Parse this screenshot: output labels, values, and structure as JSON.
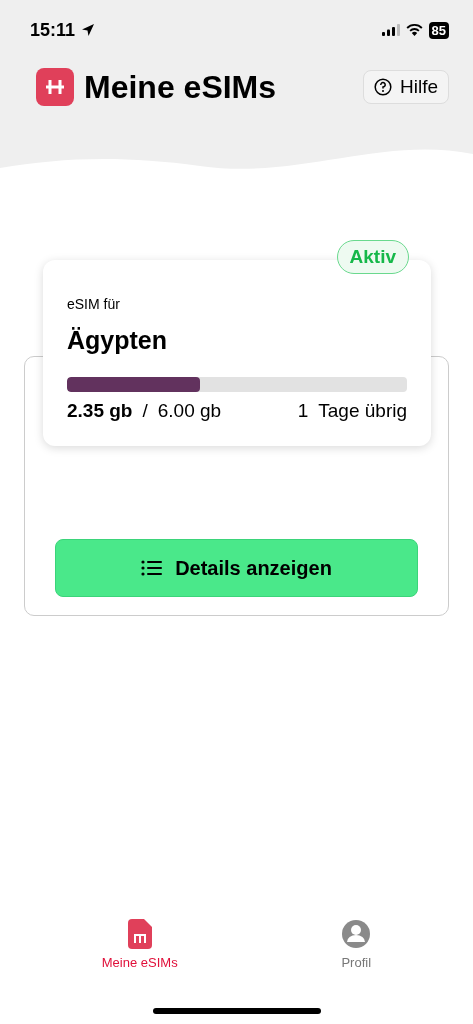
{
  "status_bar": {
    "time": "15:11",
    "battery": "85"
  },
  "header": {
    "title": "Meine eSIMs",
    "help_button": "Hilfe"
  },
  "esims": [
    {
      "label": "eSIM für",
      "country": "Ägypten",
      "status": {
        "text": "Aktiv",
        "active": true
      },
      "level": 0.39,
      "used": "2.35 gb",
      "separator": "/",
      "total": "6.00 gb",
      "days": "1",
      "days_label": "Tage übrig",
      "details_button": "Details anzeigen"
    }
  ],
  "tabs": [
    {
      "label": "Meine eSIMs",
      "kind": "sim",
      "selected": true
    },
    {
      "label": "Profil",
      "kind": "profile",
      "selected": false
    }
  ]
}
